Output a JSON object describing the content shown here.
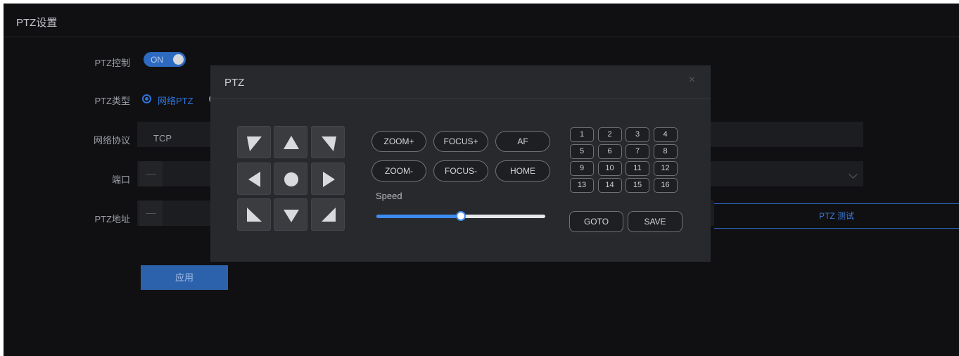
{
  "panel": {
    "title": "PTZ设置"
  },
  "form": {
    "ptz_control": {
      "label": "PTZ控制",
      "toggle_text": "ON",
      "enabled": true
    },
    "ptz_type": {
      "label": "PTZ类型",
      "selected_option": "网络PTZ"
    },
    "protocol": {
      "label": "网络协议",
      "value": "TCP"
    },
    "port": {
      "label": "端口",
      "stepper_minus": "—"
    },
    "address": {
      "label": "PTZ地址",
      "stepper_minus": "—"
    },
    "test_button": "PTZ 测试",
    "apply_button": "应用"
  },
  "modal": {
    "title": "PTZ",
    "close": "×",
    "directions": [
      {
        "name": "up-left",
        "icon": "arrow-up-left-icon"
      },
      {
        "name": "up",
        "icon": "arrow-up-icon"
      },
      {
        "name": "up-right",
        "icon": "arrow-up-right-icon"
      },
      {
        "name": "left",
        "icon": "arrow-left-icon"
      },
      {
        "name": "center",
        "icon": "circle-icon"
      },
      {
        "name": "right",
        "icon": "arrow-right-icon"
      },
      {
        "name": "down-left",
        "icon": "arrow-down-left-icon"
      },
      {
        "name": "down",
        "icon": "arrow-down-icon"
      },
      {
        "name": "down-right",
        "icon": "arrow-down-right-icon"
      }
    ],
    "buttons": {
      "zoom_in": "ZOOM+",
      "focus_in": "FOCUS+",
      "af": "AF",
      "zoom_out": "ZOOM-",
      "focus_out": "FOCUS-",
      "home": "HOME"
    },
    "speed": {
      "label": "Speed",
      "value_fraction": 0.5
    },
    "presets": [
      "1",
      "2",
      "3",
      "4",
      "5",
      "6",
      "7",
      "8",
      "9",
      "10",
      "11",
      "12",
      "13",
      "14",
      "15",
      "16"
    ],
    "goto": "GOTO",
    "save": "SAVE"
  },
  "colors": {
    "accent": "#2f73d8",
    "panel_bg": "#101013",
    "modal_bg": "#28292d",
    "slider_fill": "#3d8bf0"
  }
}
